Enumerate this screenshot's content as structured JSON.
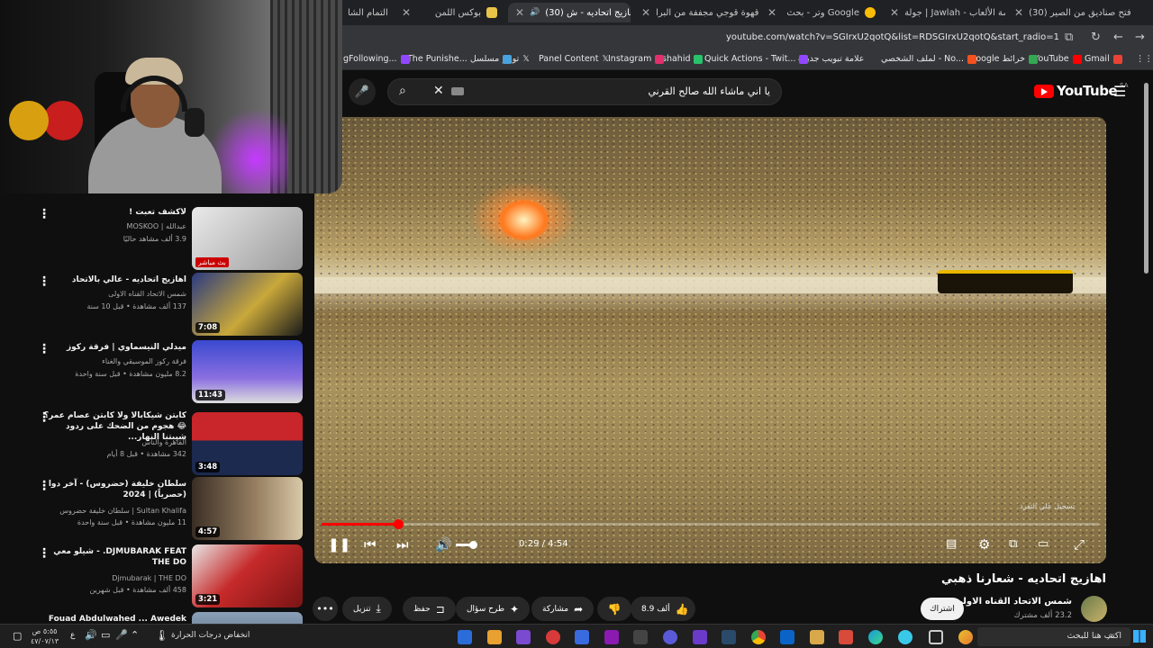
{
  "browser": {
    "tabs": [
      {
        "label": "التمام الشا",
        "fav": "#d93025"
      },
      {
        "label": "بوكس اللمن",
        "fav": "#e8c547"
      },
      {
        "label": "(30) اهازيج اتحاديه - ش",
        "fav": "#ff0000",
        "active": true
      },
      {
        "label": "قهوة قوجي مجففة من البرا",
        "fav": "#ff0000"
      },
      {
        "label": "وتر - بحث Google",
        "fav": "#fbbc05"
      },
      {
        "label": "جولة | Jawlah - منصة الألعاب",
        "fav": "#c43a8a"
      },
      {
        "label": "(30) فتح صناديق من الصير",
        "fav": "#ff0000"
      }
    ],
    "url": "youtube.com/watch?v=SGIrxU2qotQ&list=RDSGIrxU2qotQ&start_radio=1",
    "bookmarks": [
      {
        "label": "Gmail",
        "color": "#ea4335"
      },
      {
        "label": "YouTube",
        "color": "#ff0000"
      },
      {
        "label": "Google خرائط",
        "color": "#34a853"
      },
      {
        "label": "لملف الشخصي - No...",
        "color": "#f4511e"
      },
      {
        "label": "علامة تبويب جديدة",
        "color": "#888888"
      },
      {
        "label": "Quick Actions - Twit...",
        "color": "#9147ff"
      },
      {
        "label": "shahid",
        "color": "#27c26a"
      },
      {
        "label": "Instagram",
        "color": "#e1306c"
      },
      {
        "label": "Panel Content",
        "color": "#ffffff"
      },
      {
        "label": "تويتر",
        "color": "#ffffff"
      },
      {
        "label": "The Punishe... مسلسل",
        "color": "#4aa3df"
      },
      {
        "label": "gFollowing...",
        "color": "#9147ff"
      }
    ]
  },
  "youtube": {
    "search_query": "يا اني ماشاء الله صالح القرني",
    "logo_text": "YouTube",
    "region": "SA"
  },
  "player": {
    "time": "0:29 / 4:54",
    "progress": 0.099,
    "watermark": "تسجيل علي التفرد"
  },
  "video": {
    "title": "اهازيج اتحاديه - شعارنا ذهبي",
    "channel": "شمس الاتحاد القناه الاولى",
    "subs": "23.2 ألف مشترك",
    "subscribe": "اشتراك",
    "likes": "8.9 ألف",
    "share": "مشاركة",
    "ask": "طرح سؤال",
    "save": "حفظ",
    "download": "تنزيل"
  },
  "sidebar": [
    {
      "title": "لاكشف تعبت !",
      "channel": "عبدالله | MOSKOO",
      "meta": "3.9 ألف مشاهد حاليًا",
      "duration": "",
      "live": "بث مباشر",
      "thumb": "#c9c9c9"
    },
    {
      "title": "اهازيج اتحاديه - عالي بالاتحاد",
      "channel": "شمس الاتحاد القناه الاولى",
      "meta": "137 ألف مشاهدة • قبل 10 سنة",
      "duration": "7:08",
      "live": "",
      "thumb": "#c9a83a"
    },
    {
      "title": "ميدلي النيسماوي | فرقة ركوز",
      "channel": "فرقة ركوز الموسيقي والغناء",
      "meta": "8.2 مليون مشاهدة • قبل سنة واحدة",
      "duration": "11:43",
      "live": "",
      "thumb": "#3a4ad0"
    },
    {
      "title": "كابتن شيكابالا ولا كابتن عصام عمر؟ 😂 هجوم من الضحك على ردود شيبتنا النهار...",
      "channel": "القاهرة والناس",
      "meta": "342 مشاهدة • قبل 8 أيام",
      "duration": "3:48",
      "live": "",
      "thumb": "#c8262a"
    },
    {
      "title": "سلطان خليفة (حضروس) - آخر دوا (حصرياً) | 2024",
      "channel": "Sultan Khalifa | سلطان خليفة حضروس",
      "meta": "11 مليون مشاهدة • قبل سنة واحدة",
      "duration": "4:57",
      "live": "",
      "thumb": "#6e5a44"
    },
    {
      "title": "DJMUBARAK FEAT. - شيلو معي THE DO",
      "channel": "Djmubarak | THE DO",
      "meta": "458 ألف مشاهدة • قبل شهرين",
      "duration": "3:21",
      "live": "",
      "thumb": "#c62a2a"
    },
    {
      "title": "Fouad Abdulwahed ... Awedek",
      "channel": "",
      "meta": "",
      "duration": "",
      "live": "",
      "thumb": "#8aa0b8"
    }
  ],
  "taskbar": {
    "search_placeholder": "اكتب هنا للبحث",
    "weather": "انخفاض درجات الحرارة",
    "clock_time": "٥:٥٥ ص",
    "clock_date": "٤٧/٠٧/١٣"
  }
}
